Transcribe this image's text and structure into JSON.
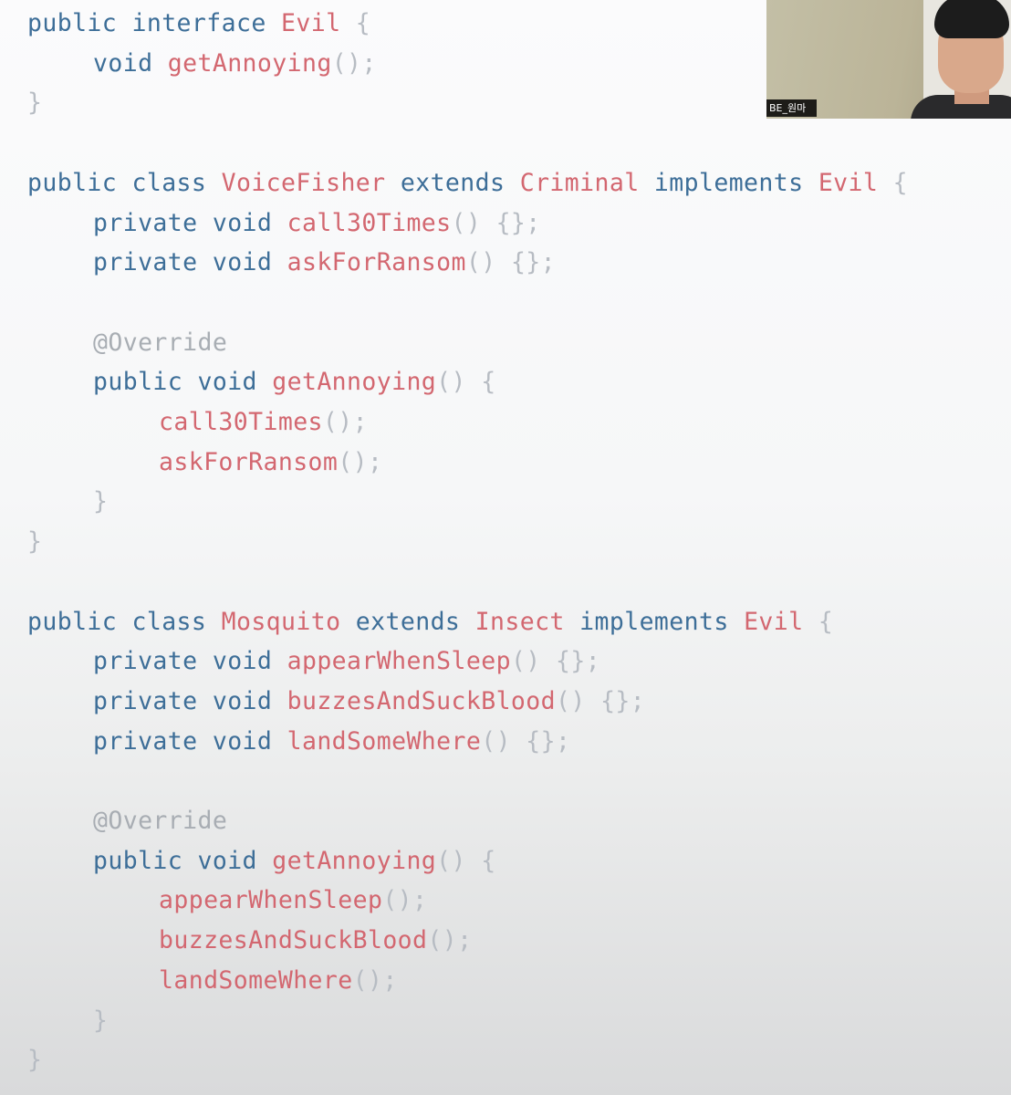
{
  "code_lines": [
    {
      "indent": 0,
      "tokens": [
        {
          "t": "kw",
          "s": "public interface "
        },
        {
          "t": "name",
          "s": "Evil"
        },
        {
          "t": "punc",
          "s": " {"
        }
      ]
    },
    {
      "indent": 1,
      "tokens": [
        {
          "t": "kw",
          "s": "void "
        },
        {
          "t": "name",
          "s": "getAnnoying"
        },
        {
          "t": "punc",
          "s": "();"
        }
      ]
    },
    {
      "indent": 0,
      "tokens": [
        {
          "t": "punc",
          "s": "}"
        }
      ]
    },
    {
      "indent": 0,
      "tokens": []
    },
    {
      "indent": 0,
      "tokens": [
        {
          "t": "kw",
          "s": "public class "
        },
        {
          "t": "name",
          "s": "VoiceFisher"
        },
        {
          "t": "kw",
          "s": " extends "
        },
        {
          "t": "name",
          "s": "Criminal"
        },
        {
          "t": "kw",
          "s": " implements "
        },
        {
          "t": "name",
          "s": "Evil"
        },
        {
          "t": "punc",
          "s": " {"
        }
      ]
    },
    {
      "indent": 1,
      "tokens": [
        {
          "t": "kw",
          "s": "private void "
        },
        {
          "t": "name",
          "s": "call30Times"
        },
        {
          "t": "punc",
          "s": "() {};"
        }
      ]
    },
    {
      "indent": 1,
      "tokens": [
        {
          "t": "kw",
          "s": "private void "
        },
        {
          "t": "name",
          "s": "askForRansom"
        },
        {
          "t": "punc",
          "s": "() {};"
        }
      ]
    },
    {
      "indent": 0,
      "tokens": []
    },
    {
      "indent": 1,
      "tokens": [
        {
          "t": "ann",
          "s": "@Override"
        }
      ]
    },
    {
      "indent": 1,
      "tokens": [
        {
          "t": "kw",
          "s": "public void "
        },
        {
          "t": "name",
          "s": "getAnnoying"
        },
        {
          "t": "punc",
          "s": "() {"
        }
      ]
    },
    {
      "indent": 2,
      "tokens": [
        {
          "t": "name",
          "s": "call30Times"
        },
        {
          "t": "punc",
          "s": "();"
        }
      ]
    },
    {
      "indent": 2,
      "tokens": [
        {
          "t": "name",
          "s": "askForRansom"
        },
        {
          "t": "punc",
          "s": "();"
        }
      ]
    },
    {
      "indent": 1,
      "tokens": [
        {
          "t": "punc",
          "s": "}"
        }
      ]
    },
    {
      "indent": 0,
      "tokens": [
        {
          "t": "punc",
          "s": "}"
        }
      ]
    },
    {
      "indent": 0,
      "tokens": []
    },
    {
      "indent": 0,
      "tokens": [
        {
          "t": "kw",
          "s": "public class "
        },
        {
          "t": "name",
          "s": "Mosquito"
        },
        {
          "t": "kw",
          "s": " extends "
        },
        {
          "t": "name",
          "s": "Insect"
        },
        {
          "t": "kw",
          "s": " implements "
        },
        {
          "t": "name",
          "s": "Evil"
        },
        {
          "t": "punc",
          "s": " {"
        }
      ]
    },
    {
      "indent": 1,
      "tokens": [
        {
          "t": "kw",
          "s": "private void "
        },
        {
          "t": "name",
          "s": "appearWhenSleep"
        },
        {
          "t": "punc",
          "s": "() {};"
        }
      ]
    },
    {
      "indent": 1,
      "tokens": [
        {
          "t": "kw",
          "s": "private void "
        },
        {
          "t": "name",
          "s": "buzzesAndSuckBlood"
        },
        {
          "t": "punc",
          "s": "() {};"
        }
      ]
    },
    {
      "indent": 1,
      "tokens": [
        {
          "t": "kw",
          "s": "private void "
        },
        {
          "t": "name",
          "s": "landSomeWhere"
        },
        {
          "t": "punc",
          "s": "() {};"
        }
      ]
    },
    {
      "indent": 0,
      "tokens": []
    },
    {
      "indent": 1,
      "tokens": [
        {
          "t": "ann",
          "s": "@Override"
        }
      ]
    },
    {
      "indent": 1,
      "tokens": [
        {
          "t": "kw",
          "s": "public void "
        },
        {
          "t": "name",
          "s": "getAnnoying"
        },
        {
          "t": "punc",
          "s": "() {"
        }
      ]
    },
    {
      "indent": 2,
      "tokens": [
        {
          "t": "name",
          "s": "appearWhenSleep"
        },
        {
          "t": "punc",
          "s": "();"
        }
      ]
    },
    {
      "indent": 2,
      "tokens": [
        {
          "t": "name",
          "s": "buzzesAndSuckBlood"
        },
        {
          "t": "punc",
          "s": "();"
        }
      ]
    },
    {
      "indent": 2,
      "tokens": [
        {
          "t": "name",
          "s": "landSomeWhere"
        },
        {
          "t": "punc",
          "s": "();"
        }
      ]
    },
    {
      "indent": 1,
      "tokens": [
        {
          "t": "punc",
          "s": "}"
        }
      ]
    },
    {
      "indent": 0,
      "tokens": [
        {
          "t": "punc",
          "s": "}"
        }
      ]
    }
  ],
  "webcam": {
    "participant_name": "BE_원마"
  },
  "colors": {
    "keyword": "#3d6e98",
    "identifier": "#d36770",
    "punctuation": "#b7bcc3",
    "annotation": "#a8adb3"
  }
}
